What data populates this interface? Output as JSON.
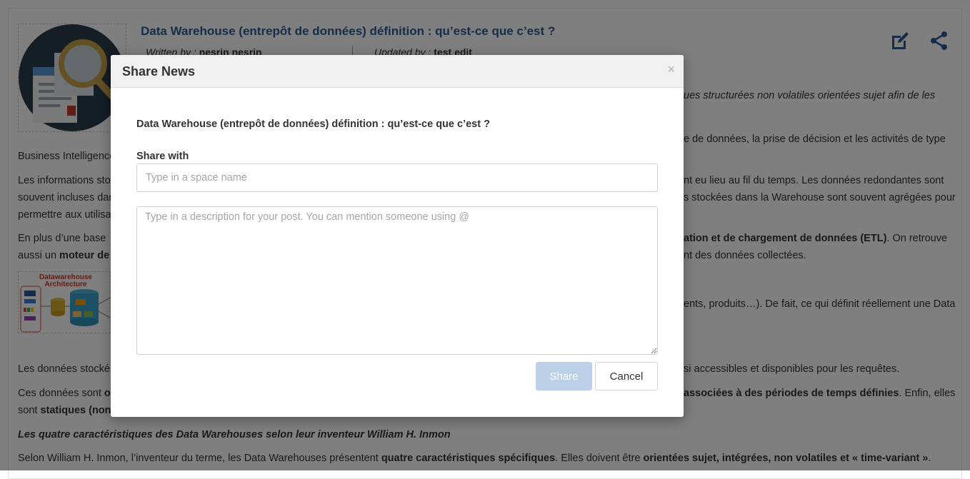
{
  "article": {
    "title": "Data Warehouse (entrepôt de données) définition : qu’est-ce que c’est ?",
    "written_by_label": "Written by :",
    "author": "nesrin nesrin",
    "updated_by_label": "Updated by :",
    "updater": "test edit",
    "lines_left": {
      "l1": "Business Intelligence",
      "l2": "Les informations sto",
      "l3": "souvent incluses dan",
      "l4": "permettre aux utilisa",
      "l5_pre": "En plus d’une base",
      "l6_pre": "aussi un ",
      "l6_bold": "moteur de",
      "l7": "Les données stocké",
      "l8_pre": "Ces données sont ",
      "l8_bold": "o",
      "l9_pre": "sont ",
      "l9_bold": "statiques (non"
    },
    "lines_right": {
      "r0": "ues structurées non volatiles orientées sujet afin de les",
      "r1": "e de données, la prise de décision et les activités de type",
      "r2": "nt eu lieu au fil du temps. Les données redondantes sont",
      "r3": "s stockées dans la Warehouse sont souvent agrégées pour",
      "r4_bold": "ation et de chargement de données (ETL)",
      "r4_post": ". On retrouve",
      "r5": "nt des données collectées.",
      "r6": "ents, produits…). De fait, ce qui définit réellement une Data",
      "r7": "si accessibles et disponibles pour les requêtes.",
      "r8_bold": "associées à des périodes de temps définies",
      "r8_post": ". Enfin, elles"
    },
    "heading": "Les quatre caractéristiques des Data Warehouses selon leur inventeur William H. Inmon",
    "last_pre": "Selon William H. Inmon, l’inventeur du terme, les Data Warehouses présentent ",
    "last_bold1": "quatre caractéristiques spécifiques",
    "last_mid": ". Elles doivent être ",
    "last_bold2": "orientées sujet, intégrées, non volatiles et « time-variant »",
    "last_post": ".",
    "arch_image_title_1": "Datawarehouse",
    "arch_image_title_2": "Architecture"
  },
  "toolbar": {
    "edit_icon": "edit-icon",
    "share_icon": "share-icon"
  },
  "modal": {
    "title": "Share News",
    "close_glyph": "×",
    "post_title": "Data Warehouse (entrepôt de données) définition : qu’est-ce que c’est ?",
    "share_with_label": "Share with",
    "space_placeholder": "Type in a space name",
    "description_placeholder": "Type in a description for your post. You can mention someone using @",
    "share_button": "Share",
    "cancel_button": "Cancel"
  },
  "colors": {
    "title_blue": "#2c5b93",
    "share_disabled": "#bcd0e8",
    "overlay": "rgba(0,0,0,0.5)"
  }
}
